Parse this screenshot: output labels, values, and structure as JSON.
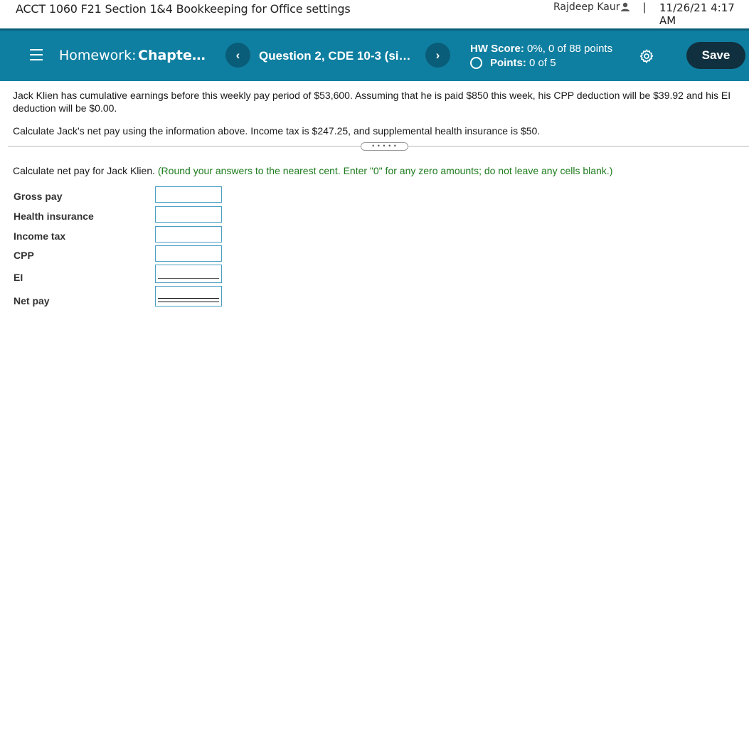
{
  "header": {
    "course_title": "ACCT 1060 F21 Section 1&4 Bookkeeping for Office settings",
    "user_name": "Rajdeep Kaur",
    "separator": "|",
    "datetime": "11/26/21 4:17 AM"
  },
  "nav": {
    "homework_label": "Homework:",
    "homework_name": "Chapter 1...",
    "question_title": "Question 2, CDE 10-3 (sim...",
    "prev_symbol": "‹",
    "next_symbol": "›",
    "hw_score_label": "HW Score:",
    "hw_score_value": "0%, 0 of 88 points",
    "points_label": "Points:",
    "points_value": "0 of 5",
    "save_label": "Save"
  },
  "question": {
    "paragraph1": "Jack Klien has cumulative earnings before this weekly pay period of $53,600. Assuming that he is paid $850 this week, his CPP deduction will be $39.92 and his EI deduction will be $0.00.",
    "paragraph2": "Calculate Jack's net pay using the information above. Income tax is $247.25, and supplemental health insurance is $50.",
    "handle": "• • • • •",
    "instruction": "Calculate net pay for Jack Klien.",
    "instruction_note": "(Round your answers to the nearest cent. Enter \"0\" for any zero amounts; do not leave any cells blank.)"
  },
  "form": {
    "rows": [
      {
        "label": "Gross pay",
        "value": ""
      },
      {
        "label": "Health insurance",
        "value": ""
      },
      {
        "label": "Income tax",
        "value": ""
      },
      {
        "label": "CPP",
        "value": ""
      },
      {
        "label": "EI",
        "value": ""
      },
      {
        "label": "Net pay",
        "value": ""
      }
    ]
  },
  "colors": {
    "navbar": "#0f7fa1",
    "save_button": "#11303f",
    "instruction_note": "#1d7b1d",
    "field_border": "#4a9ec4"
  }
}
